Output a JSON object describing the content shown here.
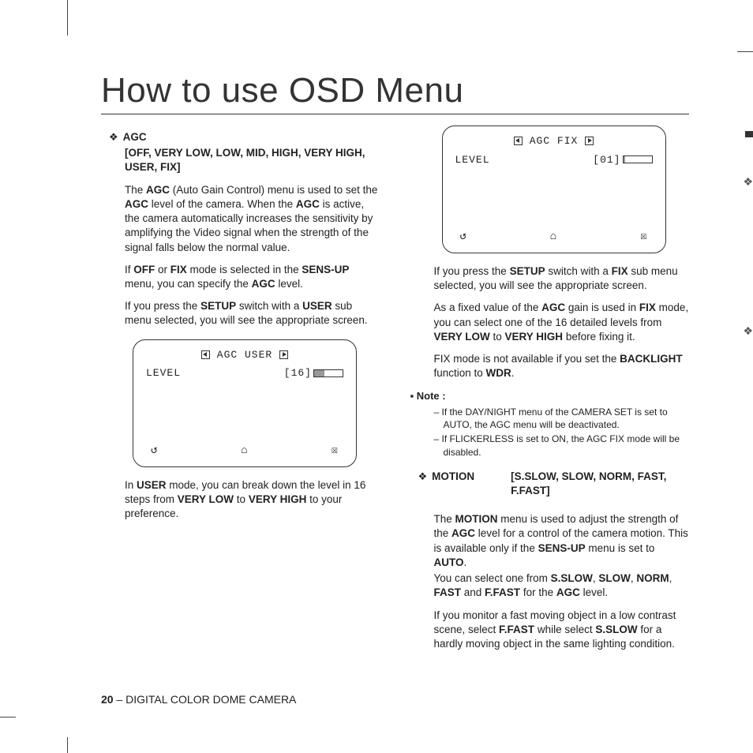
{
  "page": {
    "title": "How to use OSD Menu",
    "footer_page": "20",
    "footer_text": " – DIGITAL COLOR DOME CAMERA"
  },
  "agc": {
    "label": "AGC",
    "options": "[OFF, VERY LOW, LOW, MID, HIGH, VERY HIGH, USER, FIX]",
    "p1_a": "The ",
    "p1_b": "AGC",
    "p1_c": " (Auto Gain Control) menu is used to set the ",
    "p1_d": "AGC",
    "p1_e": " level of the camera. When the ",
    "p1_f": "AGC",
    "p1_g": " is active, the camera automatically increases the sensitivity by amplifying the Video signal when the strength of the signal falls below the normal value.",
    "p2_a": "If ",
    "p2_b": "OFF",
    "p2_c": " or ",
    "p2_d": "FIX",
    "p2_e": " mode is selected in the ",
    "p2_f": "SENS-UP",
    "p2_g": " menu, you can specify the ",
    "p2_h": "AGC",
    "p2_i": " level.",
    "p3_a": "If you press the ",
    "p3_b": "SETUP",
    "p3_c": " switch with a ",
    "p3_d": "USER",
    "p3_e": " sub menu selected, you will see the appropriate screen.",
    "p4_a": "In ",
    "p4_b": "USER",
    "p4_c": " mode, you can break down the level in 16 steps from ",
    "p4_d": "VERY LOW",
    "p4_e": " to ",
    "p4_f": "VERY HIGH",
    "p4_g": " to your preference."
  },
  "osd_user": {
    "title": "AGC USER",
    "level_label": "LEVEL",
    "level_value": "[16]",
    "fill_pct": "35"
  },
  "osd_fix": {
    "title": "AGC FIX",
    "level_label": "LEVEL",
    "level_value": "[01]",
    "fill_pct": "8"
  },
  "fix": {
    "p1_a": "If you press the ",
    "p1_b": "SETUP",
    "p1_c": " switch with a ",
    "p1_d": "FIX",
    "p1_e": " sub menu selected, you will see the appropriate screen.",
    "p2_a": "As a ﬁxed value of the ",
    "p2_b": "AGC",
    "p2_c": " gain is used in ",
    "p2_d": "FIX",
    "p2_e": " mode, you can select one of the 16 detailed levels from ",
    "p2_f": "VERY LOW",
    "p2_g": " to ",
    "p2_h": "VERY HIGH",
    "p2_i": " before ﬁxing it.",
    "p3_a": "FIX mode is not available if you set the ",
    "p3_b": "BACKLIGHT",
    "p3_c": " function to ",
    "p3_d": "WDR",
    "p3_e": "."
  },
  "note": {
    "label": "Note :",
    "n1_a": "If the ",
    "n1_b": "DAY/NIGHT",
    "n1_c": " menu of the ",
    "n1_d": "CAMERA SET",
    "n1_e": " is set to ",
    "n1_f": "AUTO",
    "n1_g": ", the ",
    "n1_h": "AGC",
    "n1_i": " menu will be deactivated.",
    "n2_a": "If ",
    "n2_b": "FLICKERLESS",
    "n2_c": " is set to ",
    "n2_d": "ON",
    "n2_e": ", the ",
    "n2_f": "AGC FIX",
    "n2_g": " mode will be disabled."
  },
  "motion": {
    "label": "MOTION",
    "options": "[S.SLOW, SLOW, NORM, FAST, F.FAST]",
    "p1_a": "The ",
    "p1_b": "MOTION",
    "p1_c": " menu is used to adjust the strength of the ",
    "p1_d": "AGC",
    "p1_e": " level for a control of the camera motion. This is available only if the ",
    "p1_f": "SENS-UP",
    "p1_g": " menu is set to ",
    "p1_h": "AUTO",
    "p1_i": ".",
    "p2_a": "You can select one from ",
    "p2_b": "S.SLOW",
    "p2_c": ", ",
    "p2_d": "SLOW",
    "p2_e": ", ",
    "p2_f": "NORM",
    "p2_g": ", ",
    "p2_h": "FAST",
    "p2_i": " and ",
    "p2_j": "F.FAST",
    "p2_k": " for the ",
    "p2_l": "AGC",
    "p2_m": " level.",
    "p3_a": "If you monitor a fast moving object in a low contrast scene, select ",
    "p3_b": "F.FAST",
    "p3_c": " while select ",
    "p3_d": "S.SLOW",
    "p3_e": " for a hardly moving object in the same lighting condition."
  }
}
